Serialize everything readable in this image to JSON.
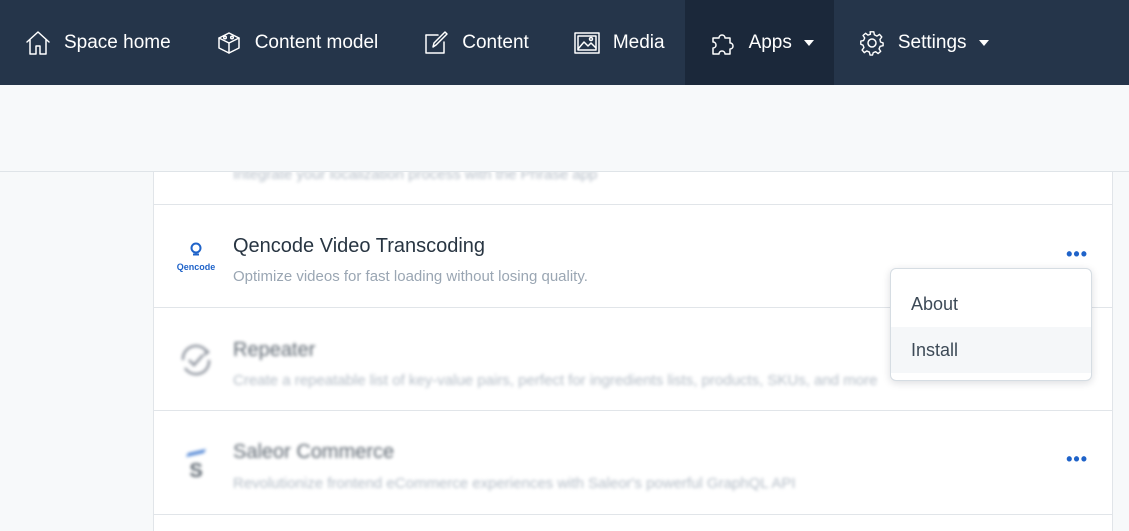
{
  "nav": {
    "items": [
      {
        "label": "Space home",
        "icon": "home-icon"
      },
      {
        "label": "Content model",
        "icon": "content-model-icon"
      },
      {
        "label": "Content",
        "icon": "content-icon"
      },
      {
        "label": "Media",
        "icon": "media-icon"
      },
      {
        "label": "Apps",
        "icon": "puzzle-icon",
        "active": true,
        "dropdown": true
      },
      {
        "label": "Settings",
        "icon": "gear-icon",
        "dropdown": true
      }
    ],
    "background": "#25354a",
    "active_background": "#1b283a"
  },
  "apps": [
    {
      "name": "",
      "description": "Integrate your localization process with the Phrase app"
    },
    {
      "name": "Qencode Video Transcoding",
      "description": "Optimize videos for fast loading without losing quality.",
      "logo_text": "Qencode"
    },
    {
      "name": "Repeater",
      "description": "Create a repeatable list of key-value pairs, perfect for ingredients lists, products, SKUs, and more"
    },
    {
      "name": "Saleor Commerce",
      "description": "Revolutionize frontend eCommerce experiences with Saleor's powerful GraphQL API",
      "logo_text": "S"
    }
  ],
  "menu": {
    "about": "About",
    "install": "Install"
  },
  "more_label": "•••",
  "accent": "#1f63c9"
}
